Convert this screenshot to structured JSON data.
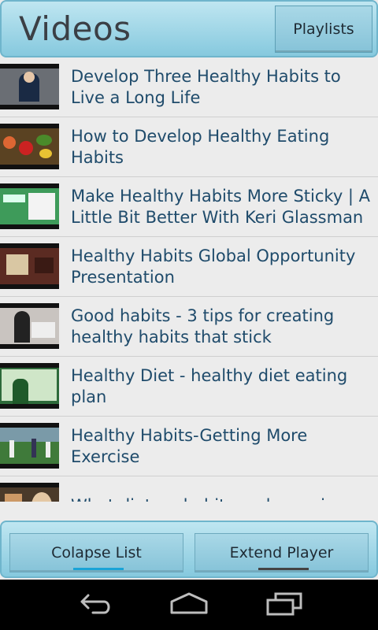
{
  "header": {
    "title": "Videos",
    "playlists_label": "Playlists"
  },
  "videos": [
    {
      "title": "Develop Three Healthy Habits to Live a Long Life",
      "thumb_color": "#6a6e74"
    },
    {
      "title": "How to Develop Healthy Eating Habits",
      "thumb_color": "#5a4222"
    },
    {
      "title": "Make Healthy Habits More Sticky | A Little Bit Better With Keri Glassman",
      "thumb_color": "#3e9b5a"
    },
    {
      "title": "Healthy Habits Global Opportunity Presentation",
      "thumb_color": "#5b2b22"
    },
    {
      "title": "Good habits - 3 tips for creating healthy habits that stick",
      "thumb_color": "#c9c4c0"
    },
    {
      "title": "Healthy Diet - healthy diet eating plan",
      "thumb_color": "#2d6a3a"
    },
    {
      "title": "Healthy Habits-Getting More Exercise",
      "thumb_color": "#3f7a3a"
    },
    {
      "title": "What dietary habits and exercise",
      "thumb_color": "#4a3a2a"
    }
  ],
  "bottom": {
    "collapse_label": "Colapse List",
    "extend_label": "Extend Player",
    "collapse_indicator_color": "#1aa3d6",
    "extend_indicator_color": "#444444"
  },
  "navbar": {
    "icons": [
      "back-icon",
      "home-icon",
      "recent-apps-icon"
    ]
  }
}
